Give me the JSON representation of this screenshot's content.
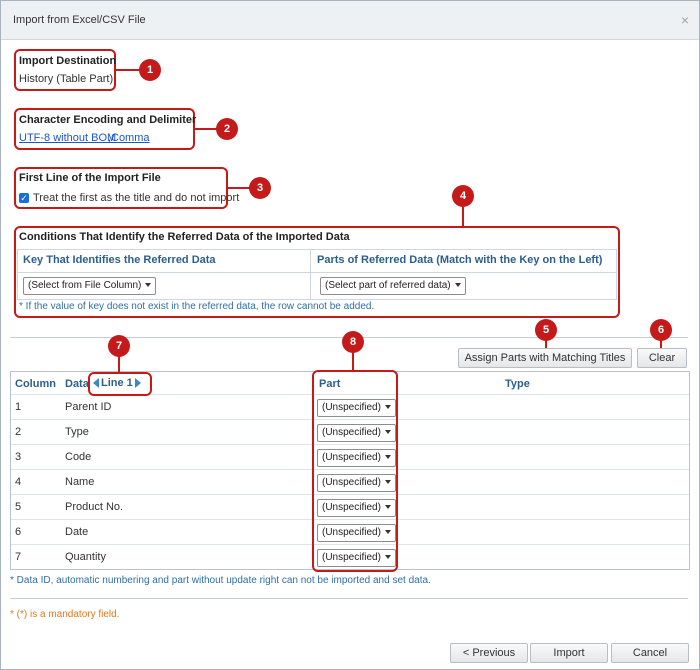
{
  "dialog": {
    "title": "Import from Excel/CSV File",
    "close_icon": "×"
  },
  "section1": {
    "heading": "Import Destination",
    "value": "History (Table Part)",
    "badge": "1"
  },
  "section2": {
    "heading": "Character Encoding and Delimiter",
    "encoding_link": "UTF-8 without BOM",
    "separator": ",",
    "delimiter_link": "Comma",
    "badge": "2"
  },
  "section3": {
    "heading": "First Line of the Import File",
    "checkbox_label": "Treat the first as the title and do not import",
    "checked": true,
    "badge": "3"
  },
  "section4": {
    "heading": "Conditions That Identify the Referred Data of the Imported Data",
    "col_key": "Key That Identifies the Referred Data",
    "col_parts": "Parts of Referred Data (Match with the Key on the Left)",
    "select_key": "(Select from File Column)",
    "select_parts": "(Select part of referred data)",
    "note": "* If the value of key does not exist in the referred data, the row cannot be added.",
    "badge": "4"
  },
  "toolbar": {
    "assign_button": "Assign Parts with Matching Titles",
    "clear_button": "Clear",
    "badge5": "5",
    "badge6": "6"
  },
  "mapping": {
    "headers": {
      "column": "Column",
      "data": "Data",
      "line_label": "Line 1",
      "part": "Part",
      "type": "Type"
    },
    "badge7": "7",
    "badge8": "8",
    "rows": [
      {
        "column": "1",
        "data": "Parent ID",
        "part": "(Unspecified)",
        "type": ""
      },
      {
        "column": "2",
        "data": "Type",
        "part": "(Unspecified)",
        "type": ""
      },
      {
        "column": "3",
        "data": "Code",
        "part": "(Unspecified)",
        "type": ""
      },
      {
        "column": "4",
        "data": "Name",
        "part": "(Unspecified)",
        "type": ""
      },
      {
        "column": "5",
        "data": "Product No.",
        "part": "(Unspecified)",
        "type": ""
      },
      {
        "column": "6",
        "data": "Date",
        "part": "(Unspecified)",
        "type": ""
      },
      {
        "column": "7",
        "data": "Quantity",
        "part": "(Unspecified)",
        "type": ""
      }
    ],
    "note": "* Data ID, automatic numbering and part without update right can not be imported and set data."
  },
  "footer": {
    "mandatory_note": "* (*) is a mandatory field.",
    "previous_button": "< Previous",
    "import_button": "Import",
    "cancel_button": "Cancel"
  },
  "colors": {
    "annotation_red": "#c41a1a",
    "header_blue": "#2c5f8e",
    "link_blue": "#1a56c8",
    "note_orange": "#e8761a"
  }
}
